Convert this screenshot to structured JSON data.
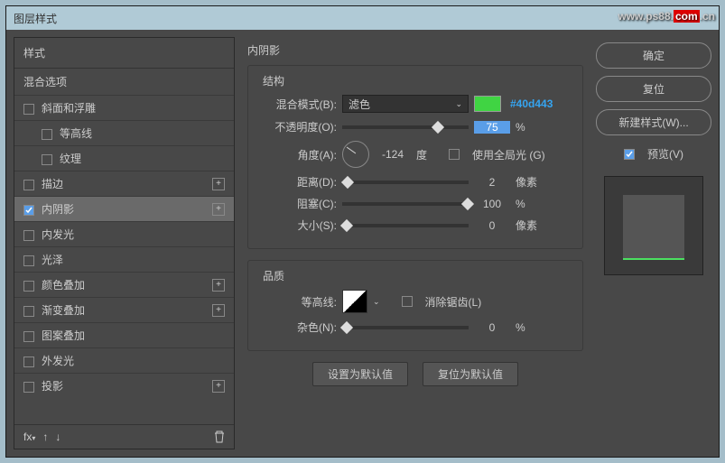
{
  "title": "图层样式",
  "watermark": {
    "a": "www.ps88.",
    "b": "com",
    "c": ".cn"
  },
  "left": {
    "styles_label": "样式",
    "blend_label": "混合选项",
    "items": [
      {
        "label": "斜面和浮雕",
        "checked": false,
        "plus": false,
        "indent": false
      },
      {
        "label": "等高线",
        "checked": false,
        "plus": false,
        "indent": true
      },
      {
        "label": "纹理",
        "checked": false,
        "plus": false,
        "indent": true
      },
      {
        "label": "描边",
        "checked": false,
        "plus": true,
        "indent": false
      },
      {
        "label": "内阴影",
        "checked": true,
        "plus": true,
        "indent": false,
        "selected": true
      },
      {
        "label": "内发光",
        "checked": false,
        "plus": false,
        "indent": false
      },
      {
        "label": "光泽",
        "checked": false,
        "plus": false,
        "indent": false
      },
      {
        "label": "颜色叠加",
        "checked": false,
        "plus": true,
        "indent": false
      },
      {
        "label": "渐变叠加",
        "checked": false,
        "plus": true,
        "indent": false
      },
      {
        "label": "图案叠加",
        "checked": false,
        "plus": false,
        "indent": false
      },
      {
        "label": "外发光",
        "checked": false,
        "plus": false,
        "indent": false
      },
      {
        "label": "投影",
        "checked": false,
        "plus": true,
        "indent": false
      }
    ],
    "fx": "fx"
  },
  "center": {
    "panel": "内阴影",
    "group1": "结构",
    "blend_mode_label": "混合模式(B):",
    "blend_mode_value": "滤色",
    "swatch": "#40d443",
    "hex": "#40d443",
    "opacity_label": "不透明度(O):",
    "opacity_value": "75",
    "pct": "%",
    "angle_label": "角度(A):",
    "angle_value": "-124",
    "deg": "度",
    "global_label": "使用全局光 (G)",
    "distance_label": "距离(D):",
    "distance_value": "2",
    "px": "像素",
    "choke_label": "阻塞(C):",
    "choke_value": "100",
    "size_label": "大小(S):",
    "size_value": "0",
    "group2": "品质",
    "contour_label": "等高线:",
    "aa_label": "消除锯齿(L)",
    "noise_label": "杂色(N):",
    "noise_value": "0",
    "btn_default": "设置为默认值",
    "btn_reset": "复位为默认值"
  },
  "right": {
    "ok": "确定",
    "cancel": "复位",
    "new_style": "新建样式(W)...",
    "preview": "预览(V)"
  }
}
